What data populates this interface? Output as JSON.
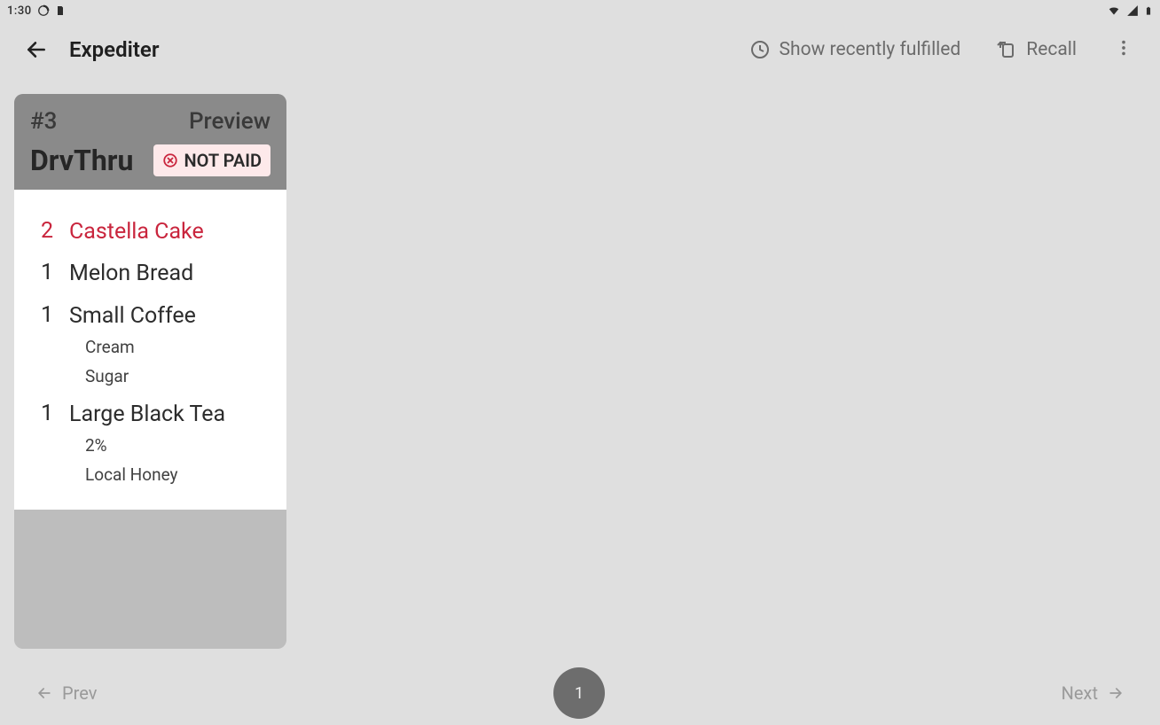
{
  "status": {
    "time": "1:30"
  },
  "appbar": {
    "title": "Expediter",
    "recent_label": "Show recently fulfilled",
    "recall_label": "Recall"
  },
  "ticket": {
    "number": "#3",
    "state": "Preview",
    "order_type": "DrvThru",
    "paid_badge": "NOT PAID",
    "items": [
      {
        "qty": "2",
        "name": "Castella Cake",
        "highlight": true,
        "mods": []
      },
      {
        "qty": "1",
        "name": "Melon Bread",
        "highlight": false,
        "mods": []
      },
      {
        "qty": "1",
        "name": "Small Coffee",
        "highlight": false,
        "mods": [
          "Cream",
          "Sugar"
        ]
      },
      {
        "qty": "1",
        "name": "Large Black Tea",
        "highlight": false,
        "mods": [
          "2%",
          "Local Honey"
        ]
      }
    ]
  },
  "pager": {
    "prev": "Prev",
    "next": "Next",
    "page": "1"
  }
}
